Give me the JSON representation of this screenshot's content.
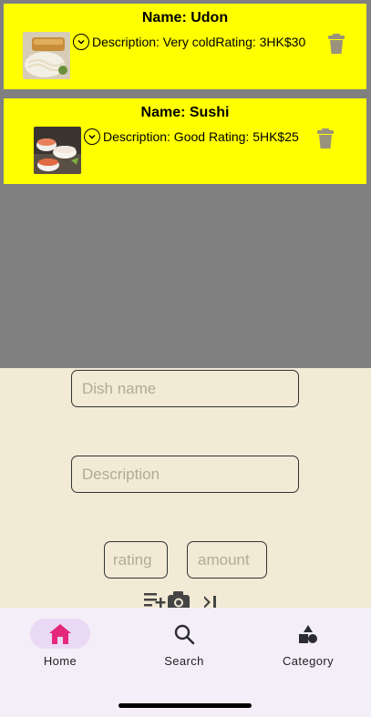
{
  "dishes": [
    {
      "name": "Name: Udon",
      "description": "Description: Very coldRating: 3HK$30",
      "image": "udon-photo"
    },
    {
      "name": "Name: Sushi",
      "description": "Description: Good Rating: 5HK$25",
      "image": "sushi-photo"
    }
  ],
  "form": {
    "dish_name_placeholder": "Dish name",
    "description_placeholder": "Description",
    "rating_placeholder": "rating",
    "amount_placeholder": "amount",
    "icons": [
      "list-add-icon",
      "camera-icon",
      "skip-next-icon"
    ]
  },
  "nav": {
    "items": [
      {
        "label": "Home",
        "icon": "home-icon",
        "active": true
      },
      {
        "label": "Search",
        "icon": "search-icon",
        "active": false
      },
      {
        "label": "Category",
        "icon": "category-icon",
        "active": false
      }
    ]
  },
  "colors": {
    "card_bg": "#ffff00",
    "list_bg": "#808080",
    "form_bg": "#f2ead5",
    "nav_bg": "#f3eef7",
    "accent": "#e5297a",
    "trash": "#9a927c"
  }
}
